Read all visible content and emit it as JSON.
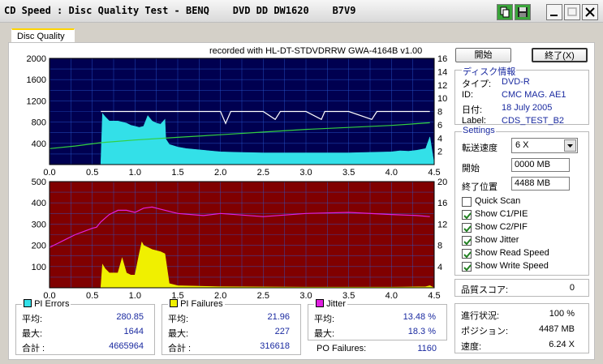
{
  "window": {
    "title": "CD Speed : Disc Quality Test - BENQ    DVD DD DW1620    B7V9",
    "tab": "Disc Quality"
  },
  "recorded_with": "recorded with HL-DT-STDVDRRW GWA-4164B v1.00",
  "buttons": {
    "start": "開始",
    "stop": "終了(X)"
  },
  "disc_info": {
    "title": "ディスク情報",
    "rows": [
      {
        "label": "タイプ:",
        "value": "DVD-R"
      },
      {
        "label": "ID:",
        "value": "CMC MAG. AE1"
      },
      {
        "label": "日付:",
        "value": "18 July 2005"
      },
      {
        "label": "Label:",
        "value": "CDS_TEST_B2"
      }
    ]
  },
  "settings": {
    "title": "Settings",
    "speed_label": "転送速度",
    "speed_value": "6 X",
    "start_label": "開始",
    "start_value": "0000 MB",
    "end_label": "終了位置",
    "end_value": "4488 MB",
    "checks": [
      {
        "label": "Quick Scan",
        "checked": false
      },
      {
        "label": "Show C1/PIE",
        "checked": true
      },
      {
        "label": "Show C2/PIF",
        "checked": true
      },
      {
        "label": "Show Jitter",
        "checked": true
      },
      {
        "label": "Show Read Speed",
        "checked": true
      },
      {
        "label": "Show Write Speed",
        "checked": true
      }
    ]
  },
  "quality": {
    "label": "品質スコア:",
    "value": "0"
  },
  "progress": {
    "rows": [
      {
        "label": "進行状況:",
        "value": "100 %"
      },
      {
        "label": "ポジション:",
        "value": "4487 MB"
      },
      {
        "label": "速度:",
        "value": "6.24 X"
      }
    ]
  },
  "pi_errors": {
    "title": "PI Errors",
    "color": "#33e0e8",
    "rows": [
      {
        "label": "平均:",
        "value": "280.85"
      },
      {
        "label": "最大:",
        "value": "1644"
      },
      {
        "label": "合計 :",
        "value": "4665964"
      }
    ]
  },
  "pi_failures": {
    "title": "PI Failures",
    "color": "#f0f000",
    "rows": [
      {
        "label": "平均:",
        "value": "21.96"
      },
      {
        "label": "最大:",
        "value": "227"
      },
      {
        "label": "合計 :",
        "value": "316618"
      }
    ]
  },
  "jitter": {
    "title": "Jitter",
    "color": "#e020e0",
    "rows": [
      {
        "label": "平均:",
        "value": "13.48 %"
      },
      {
        "label": "最大:",
        "value": "18.3 %"
      }
    ]
  },
  "po_failures": {
    "label": "PO Failures:",
    "value": "1160"
  },
  "chart_data": [
    {
      "type": "area",
      "name": "top-chart",
      "background": "#000050",
      "grid": true,
      "xlim": [
        0,
        4.5
      ],
      "x_ticks": [
        "0.0",
        "0.5",
        "1.0",
        "1.5",
        "2.0",
        "2.5",
        "3.0",
        "3.5",
        "4.0",
        "4.5"
      ],
      "ylim_left": [
        0,
        2000
      ],
      "y_ticks_left": [
        "400",
        "800",
        "1200",
        "1600",
        "2000"
      ],
      "ylim_right": [
        0,
        16
      ],
      "y_ticks_right": [
        "2",
        "4",
        "6",
        "8",
        "10",
        "12",
        "14",
        "16"
      ],
      "series": [
        {
          "color": "#33e0e8",
          "kind": "area",
          "x": [
            0.0,
            0.05,
            0.1,
            0.2,
            0.3,
            0.4,
            0.5,
            0.55,
            0.6,
            0.62,
            0.65,
            0.7,
            0.75,
            0.8,
            0.85,
            0.9,
            0.95,
            1.0,
            1.05,
            1.1,
            1.15,
            1.2,
            1.25,
            1.3,
            1.35,
            1.36,
            1.4,
            1.5,
            1.6,
            1.8,
            2.0,
            2.2,
            2.5,
            3.0,
            3.5,
            4.0,
            4.1,
            4.2,
            4.3,
            4.4,
            4.45,
            4.5
          ],
          "y": [
            0,
            0,
            0,
            0,
            0,
            0,
            0,
            0,
            0,
            960,
            900,
            820,
            820,
            820,
            800,
            780,
            740,
            720,
            700,
            720,
            920,
            820,
            780,
            760,
            850,
            480,
            380,
            330,
            300,
            270,
            240,
            230,
            220,
            220,
            220,
            240,
            260,
            250,
            270,
            300,
            520,
            0
          ]
        },
        {
          "color": "#ffffff",
          "kind": "line",
          "x": [
            0.6,
            0.8,
            1.0,
            1.3,
            1.5,
            2.0,
            2.06,
            2.12,
            2.5,
            2.64,
            2.7,
            3.0,
            3.18,
            3.22,
            3.5,
            3.77,
            3.83,
            4.2,
            4.45
          ],
          "y": [
            8,
            8,
            8,
            8,
            8,
            8,
            6.2,
            8,
            8,
            6.8,
            8,
            8,
            6.8,
            8,
            8,
            6.8,
            8,
            8,
            8
          ]
        },
        {
          "color": "#33d040",
          "kind": "line",
          "x": [
            0.0,
            0.3,
            0.6,
            1.0,
            1.5,
            2.0,
            2.5,
            3.0,
            3.5,
            4.0,
            4.45
          ],
          "y": [
            2.4,
            2.8,
            3.3,
            3.7,
            4.1,
            4.5,
            4.9,
            5.3,
            5.6,
            5.9,
            6.3
          ]
        }
      ]
    },
    {
      "type": "area",
      "name": "bottom-chart",
      "background": "#800000",
      "grid": true,
      "xlim": [
        0,
        4.5
      ],
      "x_ticks": [
        "0.0",
        "0.5",
        "1.0",
        "1.5",
        "2.0",
        "2.5",
        "3.0",
        "3.5",
        "4.0",
        "4.5"
      ],
      "ylim_left": [
        0,
        500
      ],
      "y_ticks_left": [
        "100",
        "200",
        "300",
        "400",
        "500"
      ],
      "ylim_right": [
        0,
        20
      ],
      "y_ticks_right": [
        "4",
        "8",
        "12",
        "16",
        "20"
      ],
      "series": [
        {
          "color": "#f0f000",
          "kind": "area",
          "x": [
            0.0,
            0.6,
            0.62,
            0.65,
            0.7,
            0.8,
            0.85,
            0.9,
            0.95,
            1.0,
            1.05,
            1.08,
            1.1,
            1.15,
            1.2,
            1.3,
            1.35,
            1.4,
            1.5,
            2.0,
            3.0,
            4.0,
            4.4,
            4.45,
            4.5
          ],
          "y": [
            0,
            0,
            110,
            90,
            70,
            70,
            140,
            70,
            60,
            60,
            160,
            215,
            200,
            190,
            180,
            170,
            160,
            20,
            10,
            5,
            3,
            3,
            5,
            10,
            0
          ]
        },
        {
          "color": "#e020e0",
          "kind": "line",
          "x": [
            0.0,
            0.1,
            0.2,
            0.3,
            0.4,
            0.5,
            0.55,
            0.6,
            0.7,
            0.8,
            0.9,
            1.0,
            1.1,
            1.2,
            1.3,
            1.5,
            1.8,
            2.0,
            2.5,
            3.0,
            3.5,
            4.0,
            4.3,
            4.45
          ],
          "y": [
            7.6,
            8.4,
            9.2,
            10.0,
            10.6,
            11.2,
            11.4,
            12.4,
            13.8,
            14.6,
            14.6,
            14.2,
            15.0,
            15.2,
            14.8,
            14.0,
            13.6,
            14.0,
            13.4,
            14.0,
            14.2,
            13.8,
            13.6,
            13.4
          ]
        }
      ]
    }
  ]
}
